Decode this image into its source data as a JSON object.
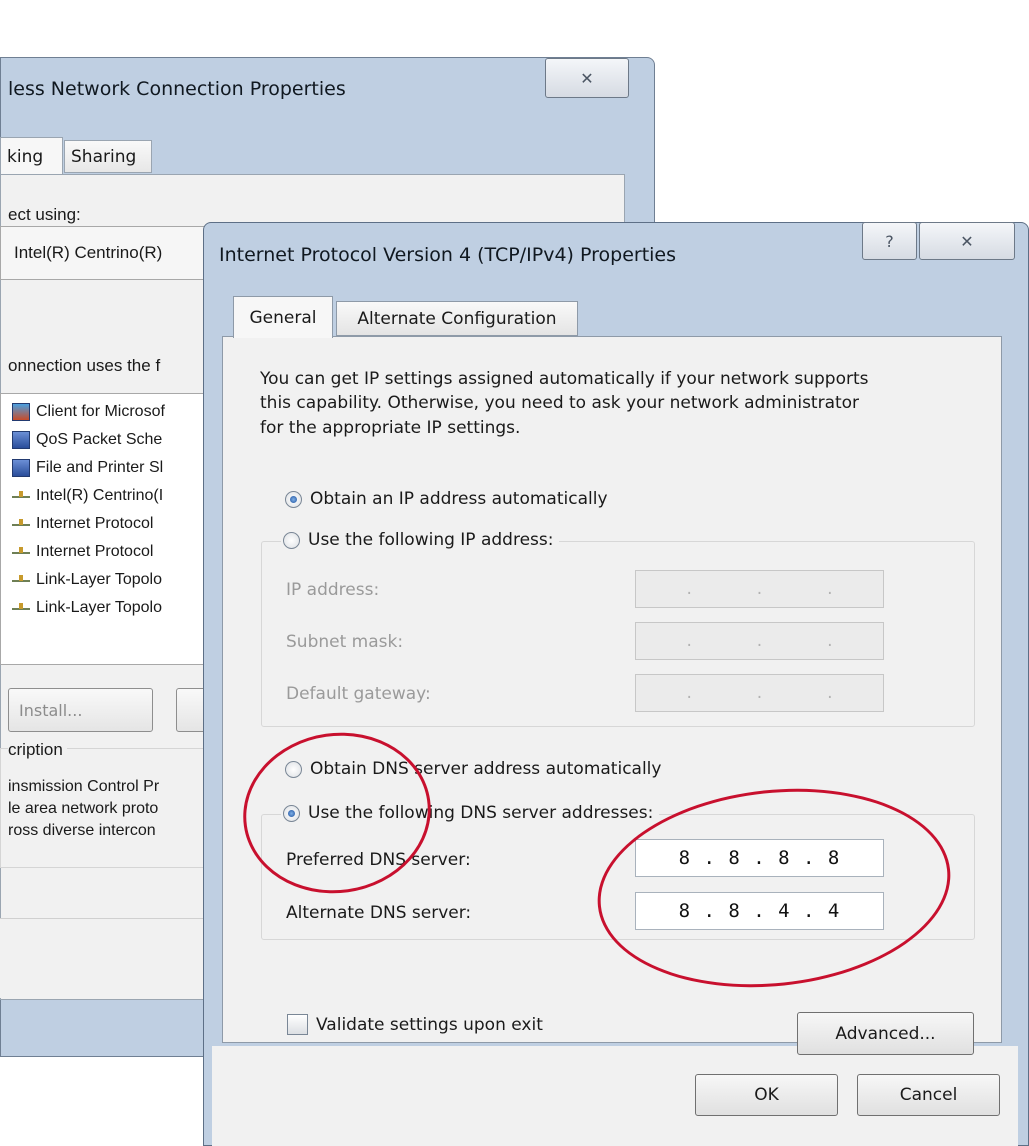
{
  "back_window": {
    "title": "less Network Connection Properties",
    "close_glyph": "✕",
    "tabs": [
      "king",
      "Sharing"
    ],
    "connect_using_label": "ect using:",
    "adapter_name": "Intel(R) Centrino(R)",
    "uses_label": "onnection uses the f",
    "items": [
      {
        "label": "Client for Microsof",
        "icon": "client-icon"
      },
      {
        "label": "QoS Packet Sche",
        "icon": "computer-icon"
      },
      {
        "label": "File and Printer Sl",
        "icon": "computer-icon"
      },
      {
        "label": "Intel(R) Centrino(I",
        "icon": "network-protocol-icon"
      },
      {
        "label": "Internet Protocol",
        "icon": "network-protocol-icon"
      },
      {
        "label": "Internet Protocol",
        "icon": "network-protocol-icon"
      },
      {
        "label": "Link-Layer Topolo",
        "icon": "network-protocol-icon"
      },
      {
        "label": "Link-Layer Topolo",
        "icon": "network-protocol-icon"
      }
    ],
    "install_button": "Install...",
    "description_label": "cription",
    "description_lines": [
      "insmission Control Pr",
      "le area network proto",
      "ross diverse intercon"
    ]
  },
  "dialog": {
    "title": "Internet Protocol Version 4 (TCP/IPv4) Properties",
    "help_glyph": "?",
    "close_glyph": "✕",
    "tabs": {
      "general": "General",
      "alternate": "Alternate Configuration"
    },
    "intro_lines": [
      "You can get IP settings assigned automatically if your network supports",
      "this capability. Otherwise, you need to ask your network administrator",
      "for the appropriate IP settings."
    ],
    "ip_auto_label": "Obtain an IP address automatically",
    "ip_manual_label": "Use the following IP address:",
    "ip_address_label": "IP address:",
    "subnet_mask_label": "Subnet mask:",
    "gateway_label": "Default gateway:",
    "empty_ip_dots": [
      ".",
      ".",
      "."
    ],
    "dns_auto_label": "Obtain DNS server address automatically",
    "dns_manual_label": "Use the following DNS server addresses:",
    "preferred_dns_label": "Preferred DNS server:",
    "preferred_dns_value": "8 . 8 . 8 . 8",
    "alternate_dns_label": "Alternate DNS server:",
    "alternate_dns_value": "8 . 8 . 4 . 4",
    "validate_label": "Validate settings upon exit",
    "advanced_button": "Advanced...",
    "ok_button": "OK",
    "cancel_button": "Cancel",
    "selected": {
      "ip_mode": "auto",
      "dns_mode": "manual",
      "validate_checked": false
    }
  },
  "annotation_color": "#c8102e"
}
